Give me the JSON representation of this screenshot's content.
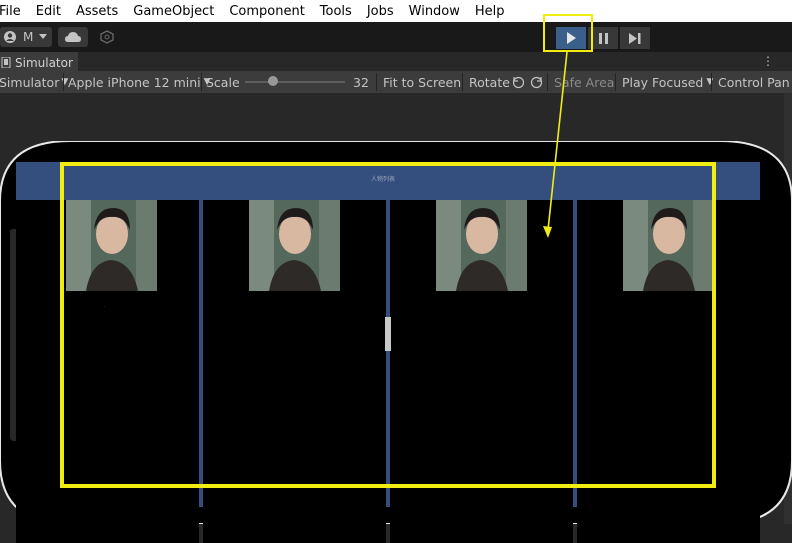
{
  "menu": [
    "File",
    "Edit",
    "Assets",
    "GameObject",
    "Component",
    "Tools",
    "Jobs",
    "Window",
    "Help"
  ],
  "toolbar": {
    "account_label": "M"
  },
  "tab": {
    "label": "Simulator"
  },
  "simulator": {
    "mode": "Simulator",
    "device": "Apple iPhone 12 mini",
    "scale_label": "Scale",
    "scale_value": "32",
    "scale_fraction": 0.28,
    "fit_label": "Fit to Screen",
    "rotate_label": "Rotate",
    "safe_area_label": "Safe Area",
    "play_focused_label": "Play Focused",
    "control_panel_label": "Control Pan"
  },
  "game": {
    "header_title": "人物列表",
    "columns": [
      "c1",
      "c2",
      "c3",
      "c4"
    ]
  },
  "colors": {
    "highlight": "#f1ed12",
    "header_blue": "#344e7d",
    "play_active": "#3a5f8a"
  }
}
